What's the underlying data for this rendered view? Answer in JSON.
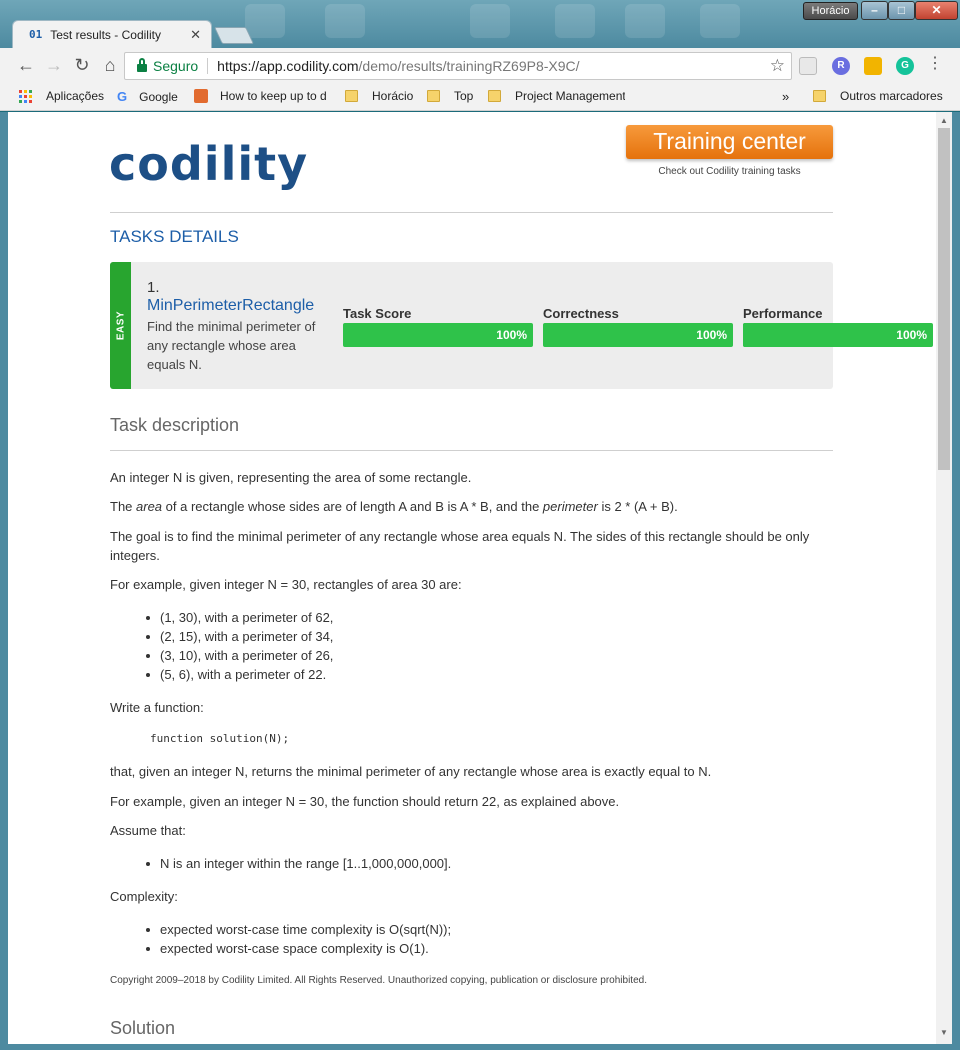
{
  "window": {
    "user_name": "Horácio",
    "minimize": "–",
    "maximize": "□",
    "close": "✕"
  },
  "tab": {
    "favicon_text": "01",
    "title": "Test results - Codility",
    "close": "✕"
  },
  "toolbar": {
    "back": "←",
    "forward": "→",
    "reload": "↻",
    "home": "⌂",
    "secure_label": "Seguro",
    "url_main": "https://app.codility.com",
    "url_path": "/demo/results/trainingRZ69P8-X9C/",
    "star": "☆",
    "ext_r": "R",
    "ext_g": "G",
    "menu": "⋮"
  },
  "bookmarks": {
    "apps": "Aplicações",
    "google": "Google",
    "how_to": "How to keep up to d",
    "horacio": "Horácio",
    "top": "Top",
    "project": "Project Management",
    "more": "»",
    "others": "Outros marcadores"
  },
  "page": {
    "logo": "codility",
    "training_button": "Training center",
    "training_sub": "Check out Codility training tasks",
    "tasks_title": "TASKS DETAILS",
    "task": {
      "difficulty": "EASY",
      "number": "1.",
      "name": "MinPerimeterRectangle",
      "description": "Find the minimal perimeter of any rectangle whose area equals N.",
      "metrics": [
        {
          "label": "Task Score",
          "value": "100%"
        },
        {
          "label": "Correctness",
          "value": "100%"
        },
        {
          "label": "Performance",
          "value": "100%"
        }
      ]
    },
    "task_description_heading": "Task description",
    "p1": "An integer N is given, representing the area of some rectangle.",
    "p2_a": "The ",
    "p2_area": "area",
    "p2_b": " of a rectangle whose sides are of length A and B is A * B, and the ",
    "p2_perimeter": "perimeter",
    "p2_c": " is 2 * (A + B).",
    "p3": "The goal is to find the minimal perimeter of any rectangle whose area equals N. The sides of this rectangle should be only integers.",
    "p4": "For example, given integer N = 30, rectangles of area 30 are:",
    "examples": [
      "(1, 30), with a perimeter of 62,",
      "(2, 15), with a perimeter of 34,",
      "(3, 10), with a perimeter of 26,",
      "(5, 6), with a perimeter of 22."
    ],
    "p5": "Write a function:",
    "code": "function solution(N);",
    "p6": "that, given an integer N, returns the minimal perimeter of any rectangle whose area is exactly equal to N.",
    "p7": "For example, given an integer N = 30, the function should return 22, as explained above.",
    "p8": "Assume that:",
    "assumptions": [
      "N is an integer within the range [1..1,000,000,000]."
    ],
    "p9": "Complexity:",
    "complexity": [
      "expected worst-case time complexity is O(sqrt(N));",
      "expected worst-case space complexity is O(1)."
    ],
    "copyright": "Copyright 2009–2018 by Codility Limited. All Rights Reserved. Unauthorized copying, publication or disclosure prohibited.",
    "solution_heading": "Solution"
  },
  "colors": {
    "brand_blue": "#1d5ea8",
    "easy_green": "#28a52f",
    "score_green": "#2fc24a",
    "training_orange": "#f08a24"
  }
}
